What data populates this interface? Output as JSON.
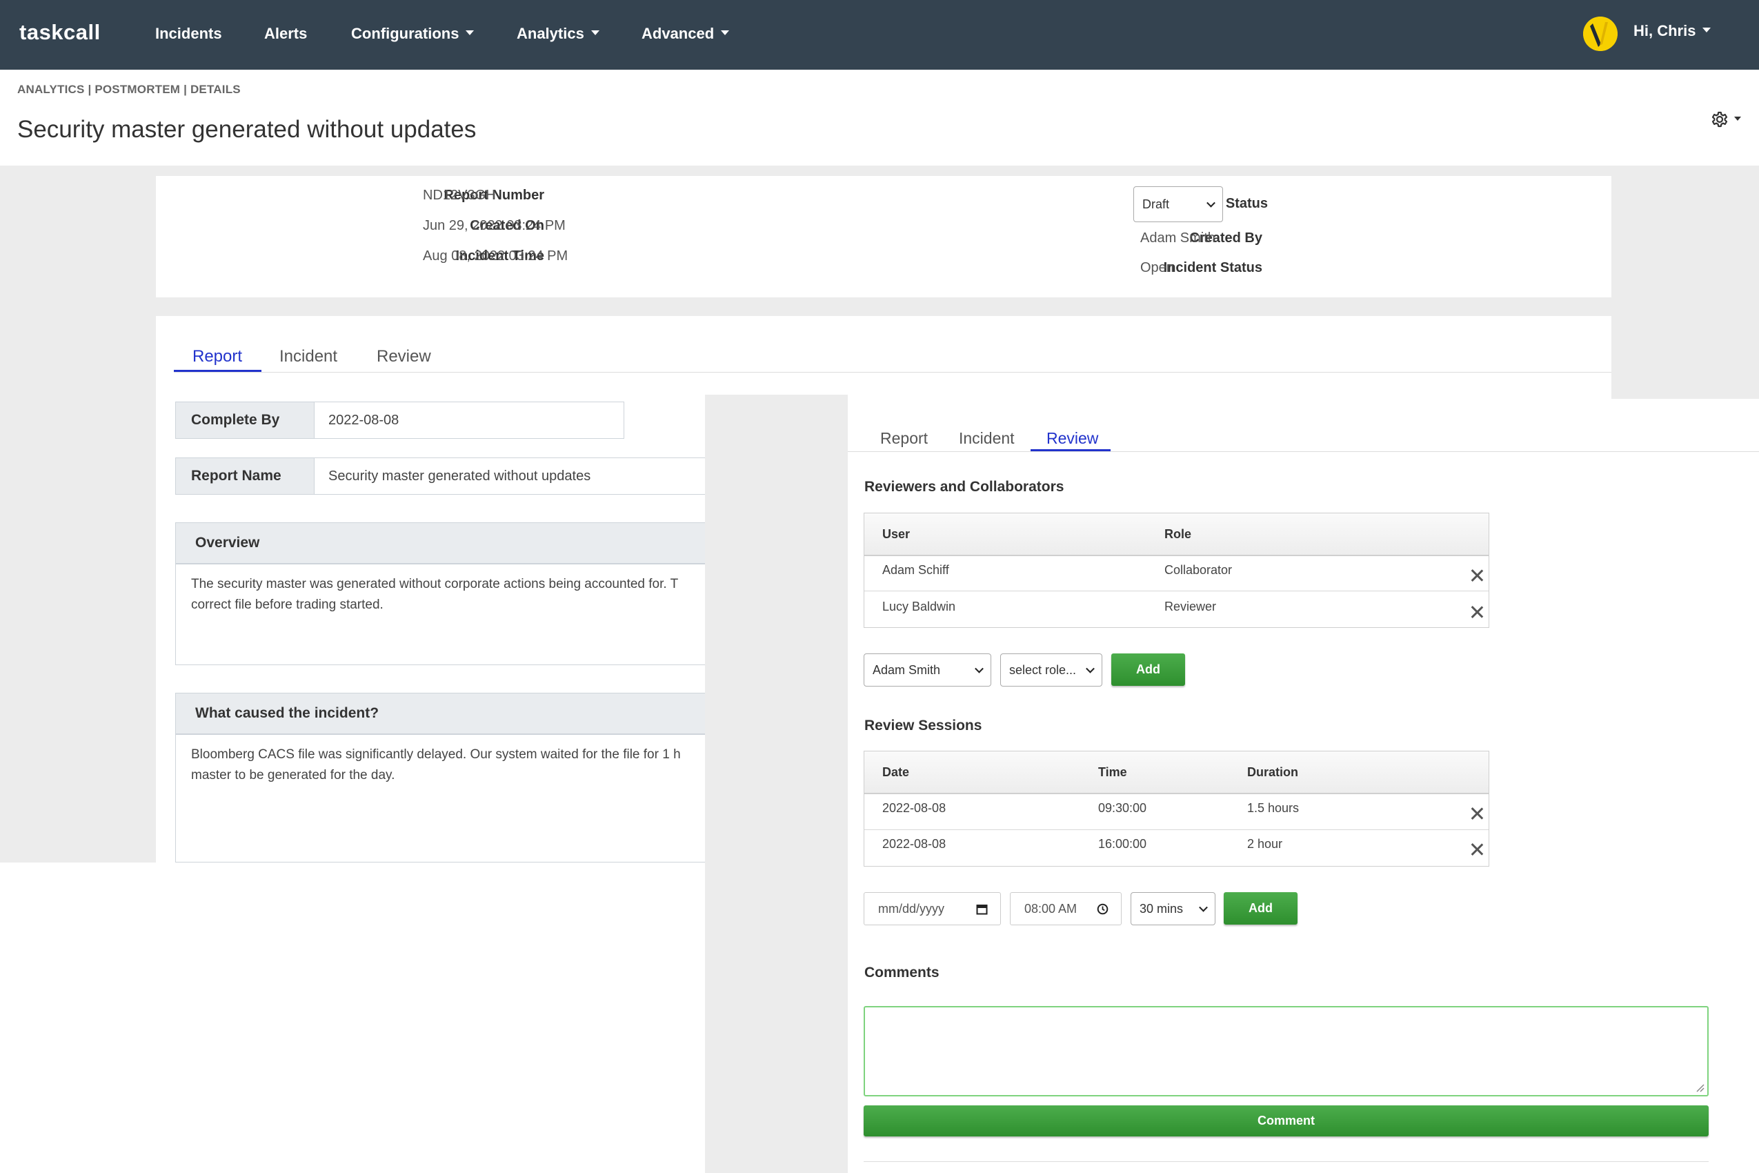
{
  "nav": {
    "logo": "taskcall",
    "items": [
      {
        "label": "Incidents",
        "dropdown": false
      },
      {
        "label": "Alerts",
        "dropdown": false
      },
      {
        "label": "Configurations",
        "dropdown": true
      },
      {
        "label": "Analytics",
        "dropdown": true
      },
      {
        "label": "Advanced",
        "dropdown": true
      }
    ],
    "user_greeting": "Hi, Chris"
  },
  "header": {
    "breadcrumb": "ANALYTICS | POSTMORTEM | DETAILS",
    "title": "Security master generated without updates"
  },
  "details": {
    "report_number_label": "Report Number",
    "report_number": "ND12V3GH",
    "created_on_label": "Created On",
    "created_on": "Jun 29, 2022 03:24 PM",
    "incident_time_label": "Incident Time",
    "incident_time": "Aug 08, 2022 03:24 PM",
    "report_status_label": "Report Status",
    "report_status": "Draft",
    "created_by_label": "Created By",
    "created_by": "Adam Smith",
    "incident_status_label": "Incident Status",
    "incident_status": "Open"
  },
  "tabs": [
    "Report",
    "Incident",
    "Review"
  ],
  "report": {
    "complete_by_label": "Complete By",
    "complete_by": "2022-08-08",
    "report_name_label": "Report Name",
    "report_name": "Security master generated without updates",
    "overview_label": "Overview",
    "overview_line1": "The security master was generated without corporate actions being accounted for. T",
    "overview_line2": "correct file before trading started.",
    "cause_label": "What caused the incident?",
    "cause_line1": "Bloomberg CACS file was significantly delayed. Our system waited for the file for 1 h",
    "cause_line2": "master to be generated for the day."
  },
  "review": {
    "reviewers_heading": "Reviewers and Collaborators",
    "reviewers_columns": [
      "User",
      "Role"
    ],
    "reviewers": [
      {
        "user": "Adam Schiff",
        "role": "Collaborator"
      },
      {
        "user": "Lucy Baldwin",
        "role": "Reviewer"
      }
    ],
    "add_user_selected": "Adam Smith",
    "add_role_placeholder": "select role...",
    "add_label": "Add",
    "sessions_heading": "Review Sessions",
    "sessions_columns": [
      "Date",
      "Time",
      "Duration"
    ],
    "sessions": [
      {
        "date": "2022-08-08",
        "time": "09:30:00",
        "duration": "1.5 hours"
      },
      {
        "date": "2022-08-08",
        "time": "16:00:00",
        "duration": "2 hour"
      }
    ],
    "date_placeholder": "mm/dd/yyyy",
    "time_value": "08:00 AM",
    "duration_selected": "30 mins",
    "comments_heading": "Comments",
    "comment_button": "Comment"
  },
  "colors": {
    "navbar": "#344350",
    "accent_blue": "#2233cc",
    "button_green": "#3a9d3a",
    "avatar_yellow": "#f7d000"
  }
}
